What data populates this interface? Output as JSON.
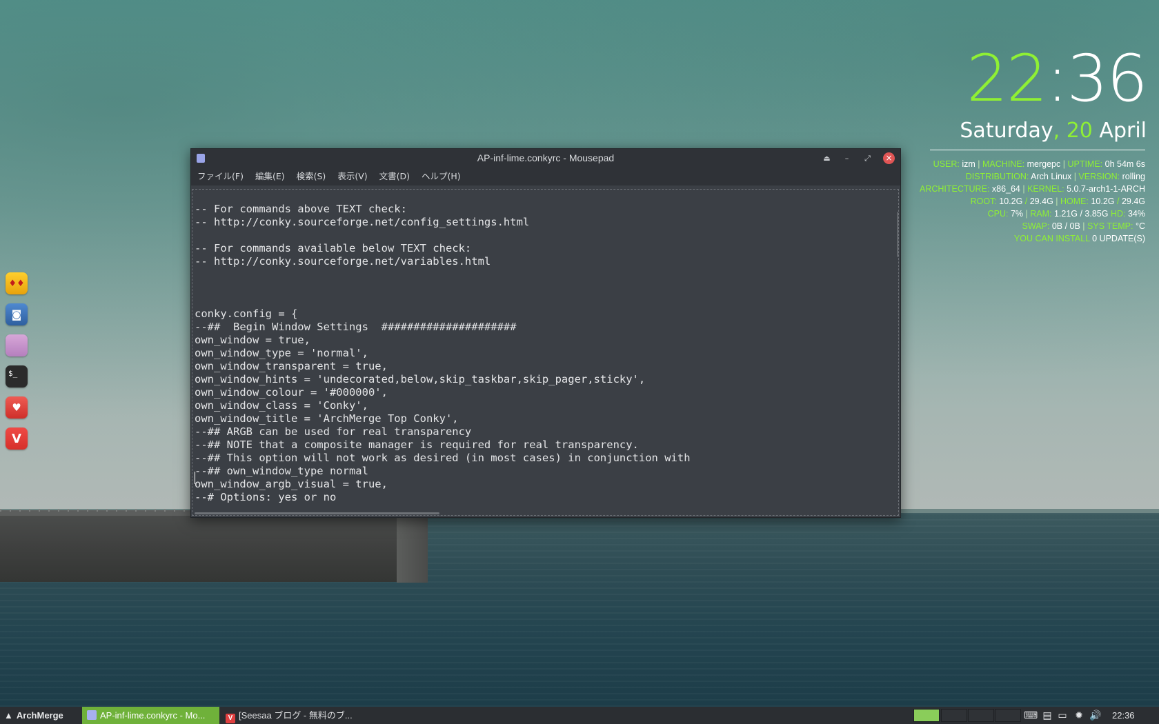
{
  "window": {
    "title": "AP-inf-lime.conkyrc - Mousepad",
    "menus": [
      "ファイル(F)",
      "編集(E)",
      "検索(S)",
      "表示(V)",
      "文書(D)",
      "ヘルプ(H)"
    ],
    "code_lines": [
      "-- For commands above TEXT check:",
      "-- http://conky.sourceforge.net/config_settings.html",
      "",
      "-- For commands available below TEXT check:",
      "-- http://conky.sourceforge.net/variables.html",
      "",
      "",
      "",
      "conky.config = {",
      "--##  Begin Window Settings  #####################",
      "own_window = true,",
      "own_window_type = 'normal',",
      "own_window_transparent = true,",
      "own_window_hints = 'undecorated,below,skip_taskbar,skip_pager,sticky',",
      "own_window_colour = '#000000',",
      "own_window_class = 'Conky',",
      "own_window_title = 'ArchMerge Top Conky',",
      "--## ARGB can be used for real transparency",
      "--## NOTE that a composite manager is required for real transparency.",
      "--## This option will not work as desired (in most cases) in conjunction with",
      "--## own_window_type normal",
      "own_window_argb_visual = true,",
      "--# Options: yes or no"
    ]
  },
  "conky": {
    "hour": "22",
    "colon": ":",
    "minute": "36",
    "weekday": "Saturday",
    "comma": ",",
    "day": "20",
    "month": "April",
    "rows": [
      [
        [
          "k",
          "USER: "
        ],
        [
          "v",
          "izm"
        ],
        [
          "s",
          " | "
        ],
        [
          "k",
          "MACHINE: "
        ],
        [
          "v",
          "mergepc"
        ],
        [
          "s",
          " | "
        ],
        [
          "k",
          "UPTIME: "
        ],
        [
          "v",
          "0h 54m 6s"
        ]
      ],
      [
        [
          "k",
          "DISTRIBUTION: "
        ],
        [
          "v",
          "Arch Linux"
        ],
        [
          "s",
          " | "
        ],
        [
          "k",
          "VERSION: "
        ],
        [
          "v",
          "rolling"
        ]
      ],
      [
        [
          "k",
          "ARCHITECTURE: "
        ],
        [
          "v",
          "x86_64"
        ],
        [
          "s",
          " | "
        ],
        [
          "k",
          "KERNEL: "
        ],
        [
          "v",
          "5.0.7-arch1-1-ARCH"
        ]
      ],
      [
        [
          "k",
          "ROOT: "
        ],
        [
          "v",
          "10.2G"
        ],
        [
          "k",
          " / "
        ],
        [
          "v",
          "29.4G"
        ],
        [
          "s",
          " | "
        ],
        [
          "k",
          "HOME: "
        ],
        [
          "v",
          "10.2G"
        ],
        [
          "k",
          " / "
        ],
        [
          "v",
          "29.4G"
        ]
      ],
      [
        [
          "k",
          "CPU: "
        ],
        [
          "v",
          "7%"
        ],
        [
          "s",
          " | "
        ],
        [
          "k",
          "RAM: "
        ],
        [
          "v",
          "1.21G / 3.85G"
        ],
        [
          "k",
          " HD: "
        ],
        [
          "v",
          "34%"
        ]
      ],
      [
        [
          "k",
          "SWAP: "
        ],
        [
          "v",
          "0B / 0B"
        ],
        [
          "s",
          " | "
        ],
        [
          "k",
          "SYS TEMP: "
        ],
        [
          "v",
          "°C"
        ]
      ],
      [
        [
          "k",
          "YOU CAN INSTALL "
        ],
        [
          "v",
          "0 UPDATE(S)"
        ]
      ]
    ],
    "colors": {
      "accent": "#8ff034",
      "text": "#ffffff"
    }
  },
  "dock": {
    "icons": [
      {
        "name": "cards-game-icon",
        "glyph": "♦♦"
      },
      {
        "name": "camera-icon",
        "glyph": "◙"
      },
      {
        "name": "folder-icon",
        "glyph": ""
      },
      {
        "name": "terminal-icon",
        "glyph": "$_"
      },
      {
        "name": "solitaire-icon",
        "glyph": "♥"
      },
      {
        "name": "vivaldi-icon",
        "glyph": "V"
      }
    ]
  },
  "taskbar": {
    "start_label": "ArchMerge",
    "tasks": [
      {
        "label": "AP-inf-lime.conkyrc - Mo...",
        "active": true
      },
      {
        "label": "[Seesaa ブログ - 無料のブ...",
        "active": false
      }
    ],
    "clock": "22:36"
  },
  "colors": {
    "accent": "#8ff034",
    "window_bg": "#3b3f45",
    "titlebar_bg": "#2f3237",
    "taskbar_bg": "#2b2e32",
    "task_active": "#6fb13a"
  }
}
